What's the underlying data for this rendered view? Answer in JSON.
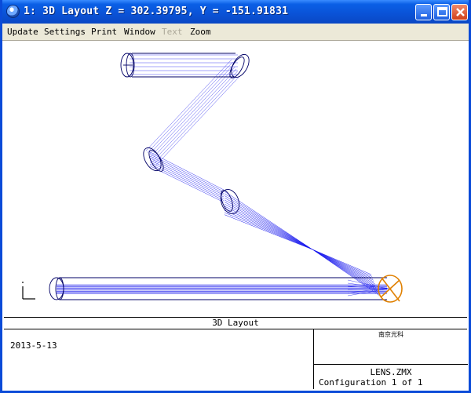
{
  "window": {
    "title": "1: 3D Layout Z = 302.39795, Y = -151.91831",
    "buttons": {
      "minimize_icon": "minimize-icon",
      "maximize_icon": "maximize-icon",
      "close_icon": "close-icon"
    }
  },
  "menu": {
    "items": [
      {
        "label": "Update",
        "enabled": true
      },
      {
        "label": "Settings",
        "enabled": true
      },
      {
        "label": "Print",
        "enabled": true
      },
      {
        "label": "Window",
        "enabled": true
      },
      {
        "label": "Text",
        "enabled": false
      },
      {
        "label": "Zoom",
        "enabled": true
      }
    ]
  },
  "plot": {
    "ray_color": "#1a1aee",
    "lens_color": "#000066",
    "detector_color": "#e08000"
  },
  "titleblock": {
    "caption": "3D Layout",
    "date": "2013-5-13",
    "company": "南京光科",
    "file": "LENS.ZMX",
    "config": "Configuration 1 of 1"
  },
  "colors": {
    "titlebar": "#0a52d6",
    "menubar": "#ece9d8",
    "border": "#0a4bd8"
  }
}
